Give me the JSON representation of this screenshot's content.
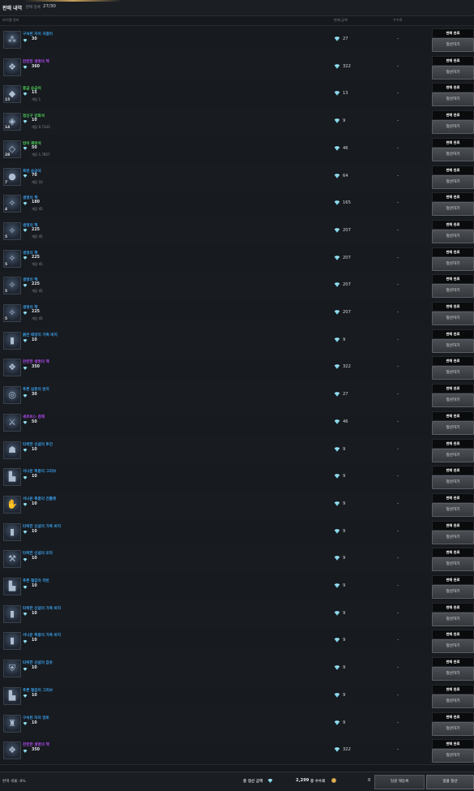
{
  "header": {
    "title": "판매 내역",
    "status_label": "판매 등록",
    "status_count": "27/30"
  },
  "columns": {
    "item_info": "아이템 정보",
    "sale_price": "판매 금액",
    "fee": "수수료"
  },
  "colors": {
    "blue": "#3a9ee8",
    "purple": "#b14af2",
    "green": "#4fd15b"
  },
  "rows": [
    {
      "name": "구속된 자의 귀걸이",
      "grade": "blue",
      "icon": "earring-icon",
      "glyph": "⁂",
      "qty": "",
      "price": "30",
      "sub": "",
      "sale": "27",
      "fee": "-",
      "status": "판매 완료",
      "action": "정산하기"
    },
    {
      "name": "찬란한 생명의 책",
      "grade": "purple",
      "icon": "book-icon",
      "glyph": "❖",
      "qty": "",
      "price": "360",
      "sub": "",
      "sale": "322",
      "fee": "-",
      "status": "판매 완료",
      "action": "정산하기"
    },
    {
      "name": "중급 승급석",
      "grade": "green",
      "icon": "stone-icon",
      "glyph": "◆",
      "qty": "15",
      "price": "15",
      "sub": "개당 1",
      "sale": "13",
      "fee": "-",
      "status": "판매 완료",
      "action": "정산하기"
    },
    {
      "name": "정신구 강화석",
      "grade": "green",
      "icon": "stone-icon",
      "glyph": "◈",
      "qty": "14",
      "price": "10",
      "sub": "개당 0.7143",
      "sale": "9",
      "fee": "-",
      "status": "판매 완료",
      "action": "정산하기"
    },
    {
      "name": "방어 재련석",
      "grade": "green",
      "icon": "stone-icon",
      "glyph": "◇",
      "qty": "28",
      "price": "50",
      "sub": "개당 1.7857",
      "sale": "46",
      "fee": "-",
      "status": "판매 완료",
      "action": "정산하기"
    },
    {
      "name": "축련 승급석",
      "grade": "blue",
      "icon": "stone-icon",
      "glyph": "●",
      "qty": "7",
      "price": "70",
      "sub": "개당 10",
      "sale": "64",
      "fee": "-",
      "status": "판매 완료",
      "action": "정산하기"
    },
    {
      "name": "생명의 책",
      "grade": "blue",
      "icon": "book-icon",
      "glyph": "✧",
      "qty": "4",
      "price": "180",
      "sub": "개당 45",
      "sale": "165",
      "fee": "-",
      "status": "판매 완료",
      "action": "정산하기"
    },
    {
      "name": "생명의 책",
      "grade": "blue",
      "icon": "book-icon",
      "glyph": "✧",
      "qty": "5",
      "price": "225",
      "sub": "개당 45",
      "sale": "207",
      "fee": "-",
      "status": "판매 완료",
      "action": "정산하기"
    },
    {
      "name": "생명의 책",
      "grade": "blue",
      "icon": "book-icon",
      "glyph": "✧",
      "qty": "5",
      "price": "225",
      "sub": "개당 45",
      "sale": "207",
      "fee": "-",
      "status": "판매 완료",
      "action": "정산하기"
    },
    {
      "name": "생명의 책",
      "grade": "blue",
      "icon": "book-icon",
      "glyph": "✧",
      "qty": "5",
      "price": "225",
      "sub": "개당 45",
      "sale": "207",
      "fee": "-",
      "status": "판매 완료",
      "action": "정산하기"
    },
    {
      "name": "생명의 책",
      "grade": "blue",
      "icon": "book-icon",
      "glyph": "✧",
      "qty": "5",
      "price": "225",
      "sub": "개당 45",
      "sale": "207",
      "fee": "-",
      "status": "판매 완료",
      "action": "정산하기"
    },
    {
      "name": "붉은 태양의 가죽 바지",
      "grade": "blue",
      "icon": "pants-icon",
      "glyph": "▮",
      "qty": "",
      "price": "10",
      "sub": "",
      "sale": "9",
      "fee": "-",
      "status": "판매 완료",
      "action": "정산하기"
    },
    {
      "name": "찬란한 생명의 책",
      "grade": "purple",
      "icon": "book-icon",
      "glyph": "❖",
      "qty": "",
      "price": "350",
      "sub": "",
      "sale": "322",
      "fee": "-",
      "status": "판매 완료",
      "action": "정산하기"
    },
    {
      "name": "푸른 심판의 반지",
      "grade": "blue",
      "icon": "ring-icon",
      "glyph": "◎",
      "qty": "",
      "price": "30",
      "sub": "",
      "sale": "27",
      "fee": "-",
      "status": "판매 완료",
      "action": "정산하기"
    },
    {
      "name": "세르비스 검해",
      "grade": "purple",
      "icon": "sword-icon",
      "glyph": "⚔",
      "qty": "",
      "price": "50",
      "sub": "",
      "sale": "46",
      "fee": "-",
      "status": "판매 완료",
      "action": "정산하기"
    },
    {
      "name": "타락한 신념의 투건",
      "grade": "blue",
      "icon": "helmet-icon",
      "glyph": "☗",
      "qty": "",
      "price": "10",
      "sub": "",
      "sale": "9",
      "fee": "-",
      "status": "판매 완료",
      "action": "정산하기"
    },
    {
      "name": "서나운 폭풍의 그리브",
      "grade": "blue",
      "icon": "boots-icon",
      "glyph": "▙",
      "qty": "",
      "price": "10",
      "sub": "",
      "sale": "9",
      "fee": "-",
      "status": "판매 완료",
      "action": "정산하기"
    },
    {
      "name": "서나운 폭풍의 건틀렛",
      "grade": "blue",
      "icon": "gauntlet-icon",
      "glyph": "✋",
      "qty": "",
      "price": "10",
      "sub": "",
      "sale": "9",
      "fee": "-",
      "status": "판매 완료",
      "action": "정산하기"
    },
    {
      "name": "타락한 신념의 가죽 바지",
      "grade": "blue",
      "icon": "pants-icon",
      "glyph": "▮",
      "qty": "",
      "price": "10",
      "sub": "",
      "sale": "9",
      "fee": "-",
      "status": "판매 완료",
      "action": "정산하기"
    },
    {
      "name": "타락한 신념의 모자",
      "grade": "blue",
      "icon": "helmet-icon",
      "glyph": "⚒",
      "qty": "",
      "price": "10",
      "sub": "",
      "sale": "9",
      "fee": "-",
      "status": "판매 완료",
      "action": "정산하기"
    },
    {
      "name": "푸른 철갑의 각반",
      "grade": "blue",
      "icon": "greaves-icon",
      "glyph": "▙",
      "qty": "",
      "price": "10",
      "sub": "",
      "sale": "9",
      "fee": "-",
      "status": "판매 완료",
      "action": "정산하기"
    },
    {
      "name": "타락한 신념의 가죽 바지",
      "grade": "blue",
      "icon": "pants-icon",
      "glyph": "▮",
      "qty": "",
      "price": "10",
      "sub": "",
      "sale": "9",
      "fee": "-",
      "status": "판매 완료",
      "action": "정산하기"
    },
    {
      "name": "서나운 폭풍의 가죽 바지",
      "grade": "blue",
      "icon": "pants-icon",
      "glyph": "▮",
      "qty": "",
      "price": "10",
      "sub": "",
      "sale": "9",
      "fee": "-",
      "status": "판매 완료",
      "action": "정산하기"
    },
    {
      "name": "타락한 신념의 갑옷",
      "grade": "blue",
      "icon": "armor-icon",
      "glyph": "⛨",
      "qty": "",
      "price": "10",
      "sub": "",
      "sale": "9",
      "fee": "-",
      "status": "판매 완료",
      "action": "정산하기"
    },
    {
      "name": "푸른 철갑의 그리브",
      "grade": "blue",
      "icon": "boots-icon",
      "glyph": "▙",
      "qty": "",
      "price": "10",
      "sub": "",
      "sale": "9",
      "fee": "-",
      "status": "판매 완료",
      "action": "정산하기"
    },
    {
      "name": "구속된 자의 망토",
      "grade": "blue",
      "icon": "cloak-icon",
      "glyph": "♜",
      "qty": "",
      "price": "10",
      "sub": "",
      "sale": "9",
      "fee": "-",
      "status": "판매 완료",
      "action": "정산하기"
    },
    {
      "name": "찬란한 생명의 책",
      "grade": "purple",
      "icon": "book-icon",
      "glyph": "❖",
      "qty": "",
      "price": "350",
      "sub": "",
      "sale": "322",
      "fee": "-",
      "status": "판매 완료",
      "action": "정산하기"
    }
  ],
  "footer": {
    "tax_label": "판매 세율: 8%",
    "total_label": "총 정산 금액",
    "total_value": "2,299",
    "fee_label": "총 수수료",
    "fee_value": "0",
    "reregister_button": "일괄 재등록",
    "settle_all_button": "일괄 정산"
  }
}
